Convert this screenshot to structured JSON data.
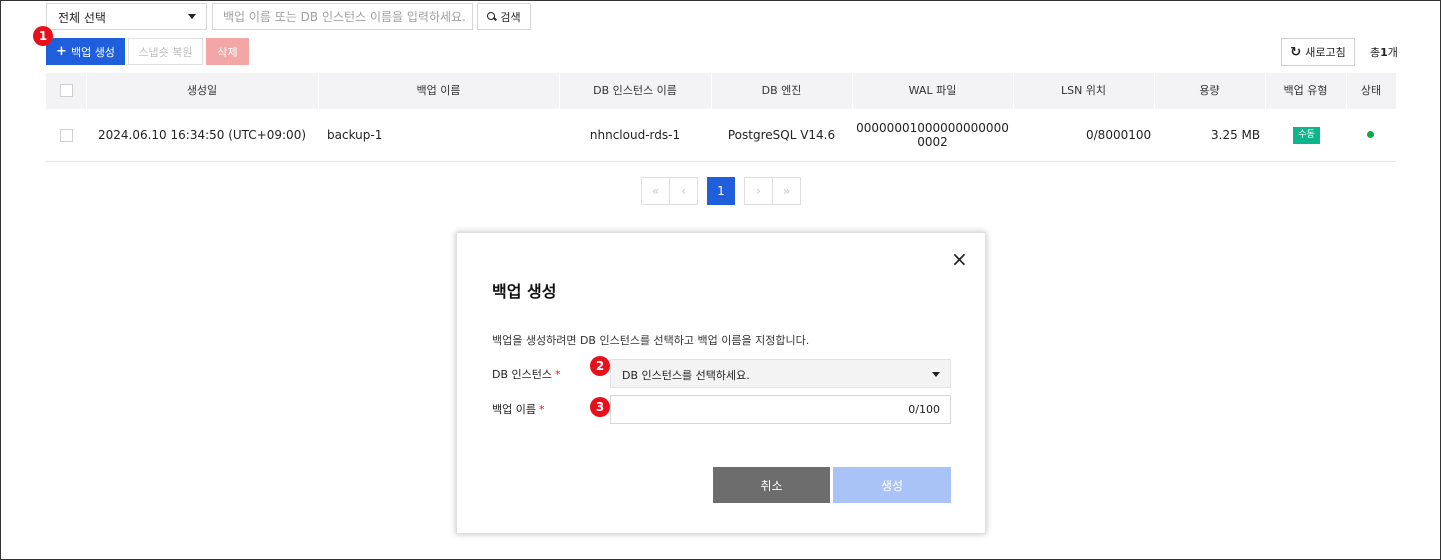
{
  "toolbar": {
    "filter_select": "전체 선택",
    "search_placeholder": "백업 이름 또는 DB 인스턴스 이름을 입력하세요.",
    "search_label": "검색",
    "create_label": "백업 생성",
    "create_plus": "+",
    "snapshot_restore_label": "스냅숏 복원",
    "delete_label": "삭제",
    "refresh_label": "새로고침",
    "refresh_icon": "↻",
    "total_prefix": "총",
    "total_count": "1",
    "total_suffix": "개"
  },
  "markers": {
    "m1": "1",
    "m2": "2",
    "m3": "3"
  },
  "table": {
    "headers": [
      "생성일",
      "백업 이름",
      "DB 인스턴스 이름",
      "DB 엔진",
      "WAL 파일",
      "LSN 위치",
      "용량",
      "백업 유형",
      "상태"
    ],
    "rows": [
      {
        "created": "2024.06.10 16:34:50 (UTC+09:00)",
        "name": "backup-1",
        "instance": "nhncloud-rds-1",
        "engine": "PostgreSQL V14.6",
        "wal_line1": "00000001000000000000",
        "wal_line2": "0002",
        "lsn": "0/8000100",
        "size": "3.25 MB",
        "type": "수동",
        "status_color": "#17a34a"
      }
    ]
  },
  "pagination": {
    "first": "«",
    "prev": "‹",
    "current": "1",
    "next": "›",
    "last": "»"
  },
  "modal": {
    "close": "×",
    "title": "백업 생성",
    "description": "백업을 생성하려면 DB 인스턴스를 선택하고 백업 이름을 지정합니다.",
    "instance_label": "DB 인스턴스",
    "instance_placeholder": "DB 인스턴스를 선택하세요.",
    "name_label": "백업 이름",
    "required_mark": "*",
    "name_counter": "0/100",
    "cancel_label": "취소",
    "submit_label": "생성"
  },
  "colors": {
    "primary": "#1f5fdc",
    "delete_disabled": "#f2a6a6",
    "marker": "#e8101a",
    "manual_tag": "#0eb48a",
    "submit_disabled": "#a9c3f7"
  }
}
